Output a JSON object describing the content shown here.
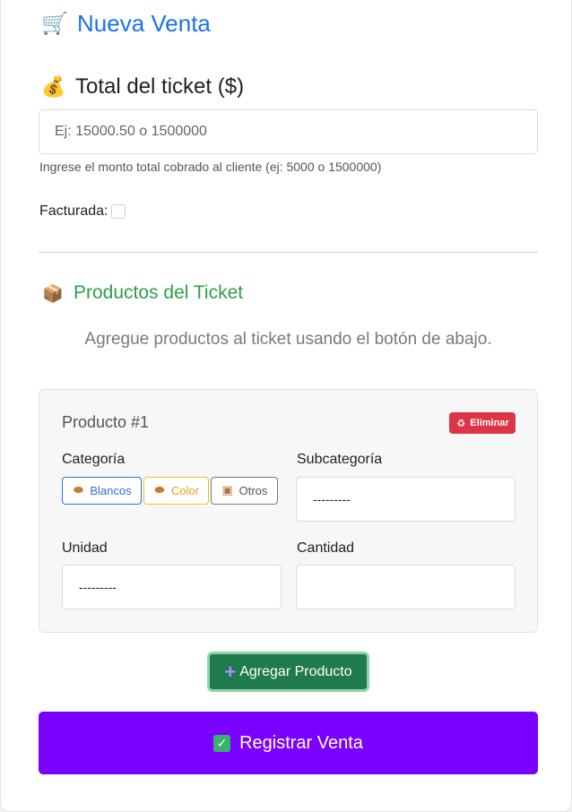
{
  "header": {
    "icon": "shopping-cart-icon",
    "title": "Nueva Venta"
  },
  "total": {
    "icon": "money-bag-icon",
    "title": "Total del ticket ($)",
    "placeholder": "Ej: 15000.50 o 1500000",
    "value": "",
    "help": "Ingrese el monto total cobrado al cliente (ej: 5000 o 1500000)"
  },
  "facturada": {
    "label": "Facturada:",
    "checked": false
  },
  "productos": {
    "icon": "package-icon",
    "title": "Productos del Ticket",
    "empty_message": "Agregue productos al ticket usando el botón de abajo."
  },
  "product_card": {
    "title": "Producto #1",
    "delete_icon": "trash-icon",
    "delete_label": "Eliminar",
    "categoria_label": "Categoría",
    "categories": [
      {
        "label": "Blancos",
        "icon": "egg-icon",
        "color": "#2f6fd6"
      },
      {
        "label": "Color",
        "icon": "egg-icon",
        "color": "#e8a21b"
      },
      {
        "label": "Otros",
        "icon": "package-icon",
        "color": "#555555"
      }
    ],
    "subcategoria_label": "Subcategoría",
    "subcategoria_value": "---------",
    "unidad_label": "Unidad",
    "unidad_value": "---------",
    "cantidad_label": "Cantidad",
    "cantidad_value": ""
  },
  "actions": {
    "add_icon": "plus-icon",
    "add_label": "Agregar Producto",
    "submit_icon": "check-box-icon",
    "submit_label": "Registrar Venta"
  },
  "colors": {
    "title_blue": "#1a73e8",
    "products_green": "#2e9e48",
    "delete_red": "#dc3545",
    "add_green": "#1f7a4c",
    "submit_purple": "#7a00ff"
  }
}
